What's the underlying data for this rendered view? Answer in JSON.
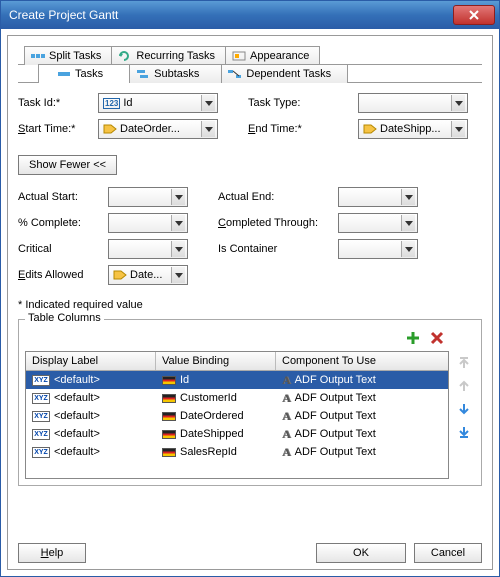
{
  "window": {
    "title": "Create Project Gantt"
  },
  "tabs_top": [
    {
      "label": "Split Tasks"
    },
    {
      "label": "Recurring Tasks"
    },
    {
      "label": "Appearance"
    }
  ],
  "tabs_sub": [
    {
      "label": "Tasks",
      "active": true
    },
    {
      "label": "Subtasks"
    },
    {
      "label": "Dependent Tasks"
    }
  ],
  "fields": {
    "task_id_label": "Task Id:*",
    "task_id_value": "Id",
    "task_type_label": "Task Type:",
    "task_type_value": "",
    "start_time_label_pre": "S",
    "start_time_label_rest": "tart Time:*",
    "start_time_value": "DateOrder...",
    "end_time_label": "End Time:*",
    "end_time_value": "DateShipp..."
  },
  "show_fewer": "Show Fewer <<",
  "fields2": {
    "actual_start": "Actual Start:",
    "actual_end": "Actual End:",
    "pct_complete": "% Complete:",
    "completed_pre": "C",
    "completed_rest": "ompleted Through:",
    "critical": "Critical",
    "is_container": "Is Container",
    "edits_pre": "E",
    "edits_rest": "dits Allowed",
    "edits_value": "Date..."
  },
  "note": "* Indicated required value",
  "table": {
    "group_title": "Table Columns",
    "headers": {
      "display": "Display Label",
      "binding": "Value Binding",
      "component": "Component To Use"
    },
    "rows": [
      {
        "display": "<default>",
        "binding": "Id",
        "component": "ADF Output Text",
        "selected": true
      },
      {
        "display": "<default>",
        "binding": "CustomerId",
        "component": "ADF Output Text"
      },
      {
        "display": "<default>",
        "binding": "DateOrdered",
        "component": "ADF Output Text"
      },
      {
        "display": "<default>",
        "binding": "DateShipped",
        "component": "ADF Output Text"
      },
      {
        "display": "<default>",
        "binding": "SalesRepId",
        "component": "ADF Output Text"
      }
    ]
  },
  "footer": {
    "help": "Help",
    "ok": "OK",
    "cancel": "Cancel"
  }
}
